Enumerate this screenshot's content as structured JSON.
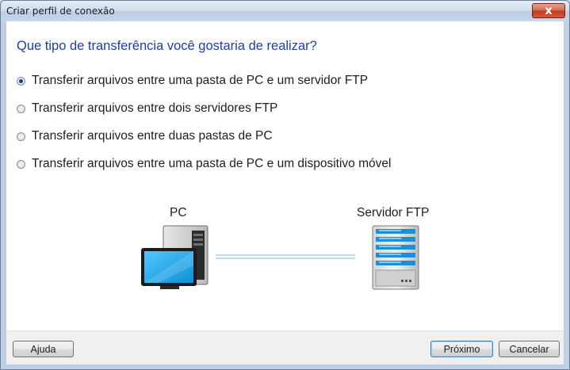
{
  "window": {
    "title": "Criar perfil de conexão",
    "close_glyph": "x"
  },
  "question": "Que tipo de transferência você gostaria de realizar?",
  "options": [
    {
      "label": "Transferir arquivos entre uma pasta de PC e um servidor FTP",
      "selected": true
    },
    {
      "label": "Transferir arquivos entre dois servidores FTP",
      "selected": false
    },
    {
      "label": "Transferir arquivos entre duas pastas de PC",
      "selected": false
    },
    {
      "label": "Transferir arquivos entre uma pasta de PC e um dispositivo móvel",
      "selected": false
    }
  ],
  "diagram": {
    "left_label": "PC",
    "right_label": "Servidor FTP",
    "left_icon": "pc-icon",
    "right_icon": "server-icon"
  },
  "footer": {
    "help_label": "Ajuda",
    "next_label": "Próximo",
    "cancel_label": "Cancelar"
  },
  "colors": {
    "question": "#1b3fa8",
    "accent": "#1a90d8",
    "link_line": "#9fd3ee"
  }
}
